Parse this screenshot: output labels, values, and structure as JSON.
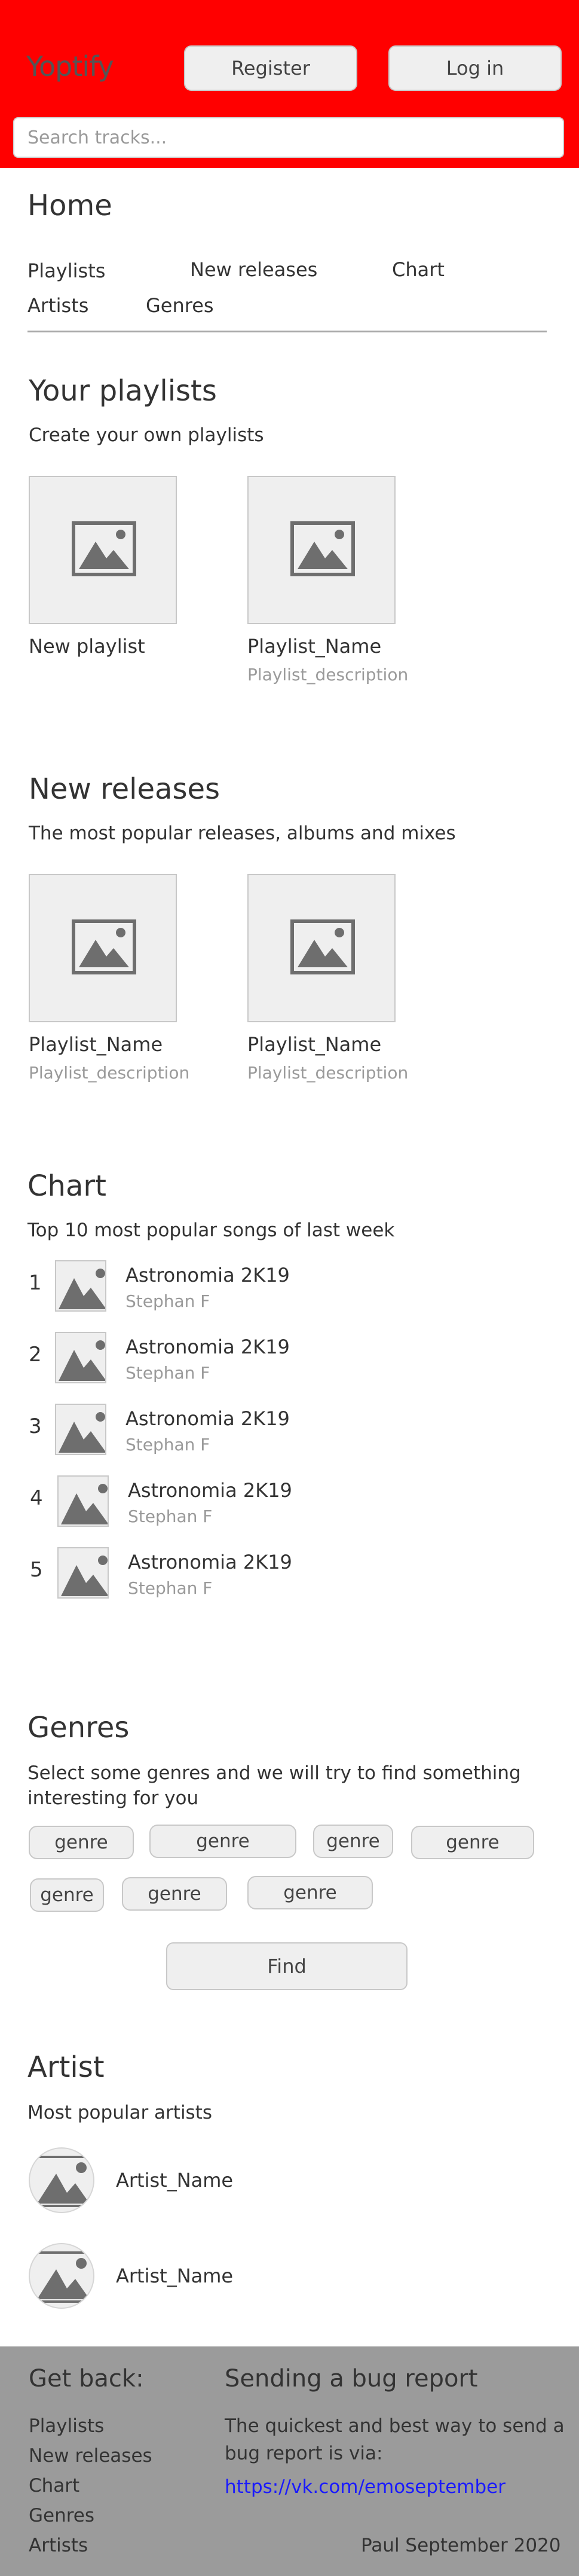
{
  "header": {
    "logo": "Yoptify",
    "register_label": "Register",
    "login_label": "Log in",
    "search_placeholder": "Search tracks..."
  },
  "nav": {
    "title": "Home",
    "links": [
      "Playlists",
      "New releases",
      "Chart",
      "Artists",
      "Genres"
    ]
  },
  "playlists": {
    "title": "Your playlists",
    "subtitle": "Create your own playlists",
    "items": [
      {
        "name": "New playlist",
        "description": ""
      },
      {
        "name": "Playlist_Name",
        "description": "Playlist_description"
      }
    ]
  },
  "new_releases": {
    "title": "New releases",
    "subtitle": "The most popular releases, albums and mixes",
    "items": [
      {
        "name": "Playlist_Name",
        "description": "Playlist_description"
      },
      {
        "name": "Playlist_Name",
        "description": "Playlist_description"
      }
    ]
  },
  "chart": {
    "title": "Chart",
    "subtitle": "Top 10 most popular songs of last week",
    "items": [
      {
        "rank": "1",
        "title": "Astronomia 2K19",
        "artist": "Stephan F"
      },
      {
        "rank": "2",
        "title": "Astronomia 2K19",
        "artist": "Stephan F"
      },
      {
        "rank": "3",
        "title": "Astronomia 2K19",
        "artist": "Stephan F"
      },
      {
        "rank": "4",
        "title": "Astronomia 2K19",
        "artist": "Stephan F"
      },
      {
        "rank": "5",
        "title": "Astronomia 2K19",
        "artist": "Stephan F"
      }
    ]
  },
  "genres": {
    "title": "Genres",
    "subtitle_line1": "Select some genres and we will try to find something",
    "subtitle_line2": "interesting for you",
    "items": [
      "genre",
      "genre",
      "genre",
      "genre",
      "genre",
      "genre",
      "genre"
    ],
    "find_label": "Find"
  },
  "artists": {
    "title": "Artist",
    "subtitle": "Most popular artists",
    "items": [
      {
        "name": "Artist_Name"
      },
      {
        "name": "Artist_Name"
      }
    ]
  },
  "footer": {
    "get_back_title": "Get back:",
    "links": [
      "Playlists",
      "New releases",
      "Chart",
      "Genres",
      "Artists"
    ],
    "bug_title": "Sending a bug report",
    "bug_text_line1": "The quickest and best way to send a",
    "bug_text_line2": "bug report is via:",
    "bug_link": "https://vk.com/emoseptember",
    "copyright": "Paul September 2020"
  },
  "colors": {
    "header_bg": "#ff0000",
    "footer_bg": "#9b9b9b",
    "link": "#1a1aff"
  },
  "icons": {
    "thumbnail": "image-placeholder-icon"
  }
}
